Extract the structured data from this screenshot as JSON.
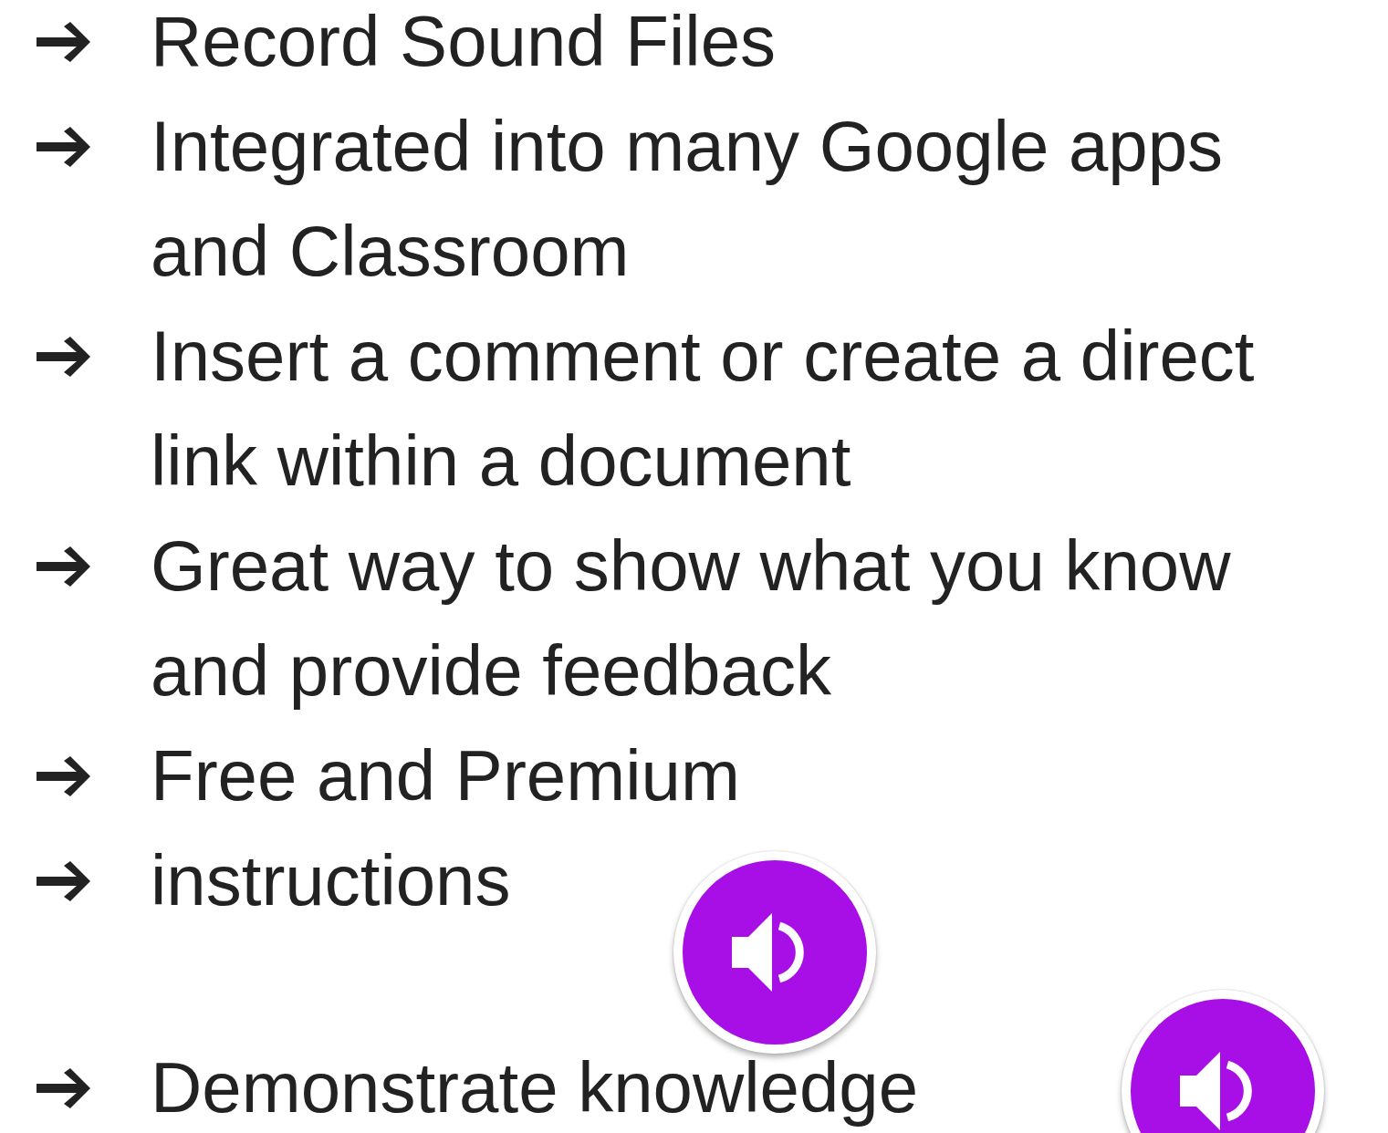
{
  "bullets": [
    {
      "lines": [
        "Record Sound Files"
      ]
    },
    {
      "lines": [
        "Integrated into many Google apps",
        "and Classroom"
      ]
    },
    {
      "lines": [
        "Insert a comment or create a direct",
        "link within a document"
      ]
    },
    {
      "lines": [
        "Great way to show what you know",
        "and provide feedback"
      ]
    },
    {
      "lines": [
        "Free and Premium"
      ]
    },
    {
      "lines": [
        "instructions"
      ]
    },
    {
      "lines": [
        "Demonstrate knowledge"
      ]
    }
  ]
}
